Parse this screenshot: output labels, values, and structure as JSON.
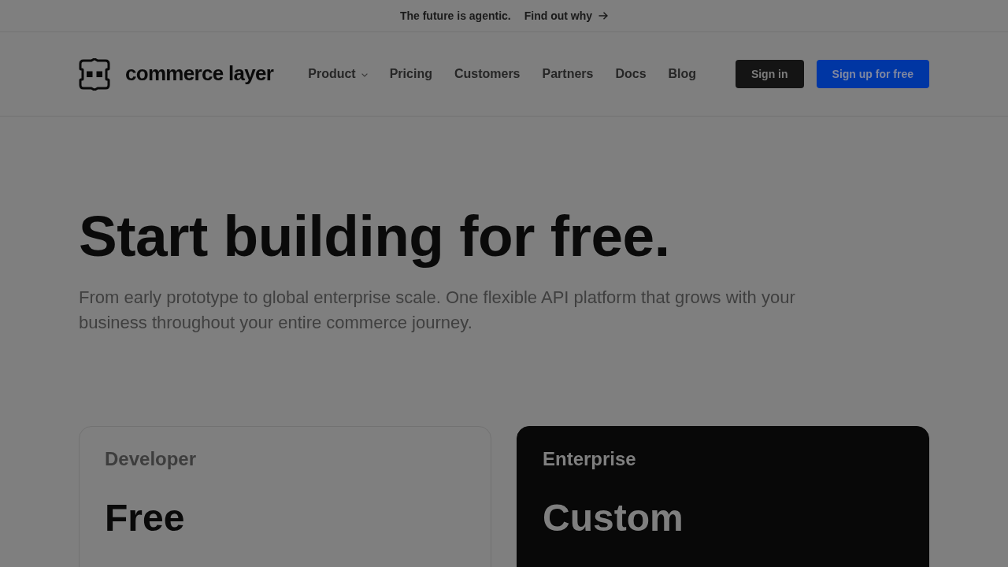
{
  "banner": {
    "text": "The future is agentic.",
    "link": "Find out why"
  },
  "header": {
    "logo": "commerce layer",
    "nav": [
      {
        "label": "Product",
        "has_menu": true
      },
      {
        "label": "Pricing",
        "has_menu": false
      },
      {
        "label": "Customers",
        "has_menu": false
      },
      {
        "label": "Partners",
        "has_menu": false
      },
      {
        "label": "Docs",
        "has_menu": false
      },
      {
        "label": "Blog",
        "has_menu": false
      }
    ],
    "buttons": [
      {
        "label": "Sign in",
        "kind": "secondary"
      },
      {
        "label": "Sign up for free",
        "kind": "primary"
      }
    ]
  },
  "hero": {
    "title": "Start building for free.",
    "subtitle": "From early prototype to global enterprise scale. One flexible API platform that grows with your business throughout your entire commerce journey."
  },
  "plans": [
    {
      "name": "Developer",
      "price": "Free",
      "kind": "light"
    },
    {
      "name": "Enterprise",
      "price": "Custom",
      "kind": "dark"
    }
  ]
}
